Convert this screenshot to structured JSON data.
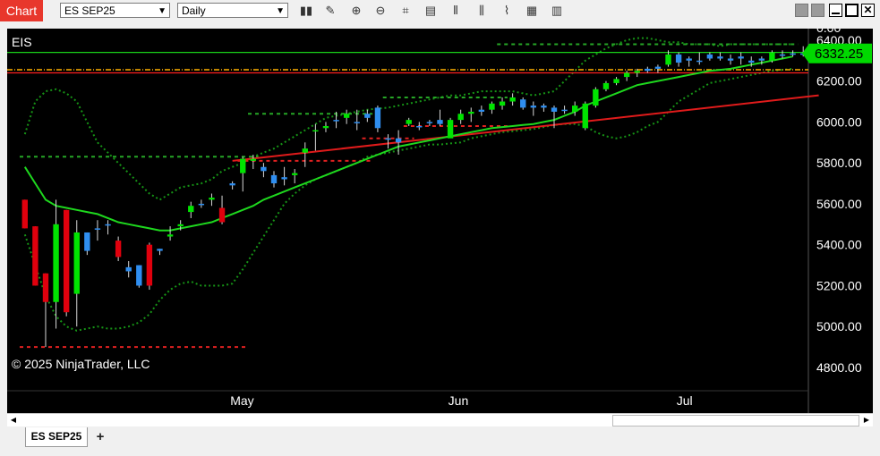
{
  "toolbar": {
    "chart_label": "Chart",
    "instrument": "ES SEP25",
    "interval": "Daily",
    "icons": [
      "bars-type-icon",
      "draw-pencil-icon",
      "zoom-in-icon",
      "zoom-out-icon",
      "crosshair-icon",
      "data-box-icon",
      "indicators-icon",
      "strategies-icon",
      "templates-icon",
      "properties-icon",
      "more-icon"
    ]
  },
  "chart": {
    "instrument_label": "EIS",
    "copyright": "© 2025 NinjaTrader, LLC",
    "last_price": "6332.25",
    "colors": {
      "background": "#000000",
      "up_candle": "#00e400",
      "down_candle": "#e0000d",
      "neutral_candle": "#2f8ef0",
      "sma": "#1ed81e",
      "trend": "#e01b1b",
      "bollinger": "#169416",
      "price_marker": "#00d900",
      "axis_text": "#ffffff"
    }
  },
  "chart_data": {
    "type": "candlestick",
    "y_ticks": [
      "0.00",
      "6400.00",
      "6200.00",
      "6000.00",
      "5800.00",
      "5600.00",
      "5400.00",
      "5200.00",
      "5000.00",
      "4800.00"
    ],
    "ylim": [
      4730,
      6500
    ],
    "x_labels": [
      "May",
      "Jun",
      "Jul"
    ],
    "ohlc": [
      [
        5620,
        5620,
        5480,
        5480,
        "r"
      ],
      [
        5490,
        5490,
        5200,
        5200,
        "r"
      ],
      [
        5260,
        5260,
        4900,
        5120,
        "r"
      ],
      [
        5120,
        5620,
        4990,
        5500,
        "g"
      ],
      [
        5570,
        5570,
        5050,
        5070,
        "r"
      ],
      [
        5160,
        5520,
        5000,
        5460,
        "g"
      ],
      [
        5460,
        5460,
        5350,
        5370,
        "b"
      ],
      [
        5480,
        5520,
        5420,
        5480,
        "b"
      ],
      [
        5500,
        5520,
        5450,
        5500,
        "b"
      ],
      [
        5420,
        5440,
        5320,
        5340,
        "r"
      ],
      [
        5290,
        5320,
        5240,
        5270,
        "b"
      ],
      [
        5300,
        5300,
        5190,
        5200,
        "b"
      ],
      [
        5400,
        5410,
        5180,
        5200,
        "r"
      ],
      [
        5370,
        5380,
        5350,
        5380,
        "b"
      ],
      [
        5440,
        5490,
        5420,
        5450,
        "g"
      ],
      [
        5490,
        5520,
        5470,
        5500,
        "g"
      ],
      [
        5560,
        5610,
        5530,
        5590,
        "g"
      ],
      [
        5600,
        5620,
        5580,
        5600,
        "b"
      ],
      [
        5620,
        5650,
        5590,
        5630,
        "g"
      ],
      [
        5510,
        5640,
        5500,
        5580,
        "r"
      ],
      [
        5690,
        5710,
        5670,
        5700,
        "b"
      ],
      [
        5750,
        5830,
        5660,
        5820,
        "g"
      ],
      [
        5820,
        5840,
        5770,
        5810,
        "g"
      ],
      [
        5780,
        5800,
        5730,
        5760,
        "b"
      ],
      [
        5740,
        5760,
        5680,
        5700,
        "b"
      ],
      [
        5730,
        5780,
        5690,
        5720,
        "b"
      ],
      [
        5740,
        5770,
        5700,
        5750,
        "g"
      ],
      [
        5850,
        5900,
        5780,
        5870,
        "g"
      ],
      [
        5960,
        5990,
        5860,
        5960,
        "g"
      ],
      [
        5970,
        6000,
        5950,
        5980,
        "g"
      ],
      [
        6010,
        6050,
        5970,
        6010,
        "b"
      ],
      [
        6020,
        6060,
        5990,
        6040,
        "g"
      ],
      [
        6000,
        6060,
        5960,
        6000,
        "b"
      ],
      [
        6040,
        6060,
        6000,
        6020,
        "b"
      ],
      [
        6070,
        6080,
        5950,
        5970,
        "b"
      ],
      [
        5920,
        5940,
        5870,
        5920,
        "b"
      ],
      [
        5900,
        5960,
        5840,
        5920,
        "b"
      ],
      [
        5990,
        6020,
        5980,
        6010,
        "g"
      ],
      [
        5980,
        6000,
        5960,
        5980,
        "b"
      ],
      [
        6000,
        6010,
        5980,
        6000,
        "b"
      ],
      [
        6010,
        6060,
        5980,
        5990,
        "b"
      ],
      [
        5920,
        6020,
        5940,
        6010,
        "g"
      ],
      [
        6010,
        6060,
        5990,
        6040,
        "g"
      ],
      [
        6040,
        6070,
        6000,
        6050,
        "g"
      ],
      [
        6050,
        6080,
        6030,
        6060,
        "b"
      ],
      [
        6060,
        6100,
        6040,
        6090,
        "g"
      ],
      [
        6080,
        6120,
        6060,
        6100,
        "g"
      ],
      [
        6100,
        6140,
        6080,
        6120,
        "g"
      ],
      [
        6110,
        6120,
        6060,
        6070,
        "b"
      ],
      [
        6080,
        6100,
        6030,
        6070,
        "b"
      ],
      [
        6070,
        6090,
        6050,
        6080,
        "b"
      ],
      [
        6050,
        6080,
        5970,
        6070,
        "b"
      ],
      [
        6060,
        6080,
        6040,
        6060,
        "b"
      ],
      [
        6050,
        6100,
        6030,
        6080,
        "g"
      ],
      [
        5970,
        6100,
        5960,
        6090,
        "g"
      ],
      [
        6080,
        6170,
        6070,
        6160,
        "g"
      ],
      [
        6160,
        6200,
        6150,
        6190,
        "g"
      ],
      [
        6190,
        6220,
        6180,
        6210,
        "g"
      ],
      [
        6220,
        6250,
        6200,
        6240,
        "g"
      ],
      [
        6240,
        6260,
        6220,
        6250,
        "g"
      ],
      [
        6250,
        6270,
        6240,
        6260,
        "b"
      ],
      [
        6260,
        6280,
        6240,
        6270,
        "b"
      ],
      [
        6280,
        6350,
        6270,
        6330,
        "g"
      ],
      [
        6330,
        6340,
        6270,
        6290,
        "b"
      ],
      [
        6300,
        6320,
        6270,
        6310,
        "b"
      ],
      [
        6300,
        6340,
        6280,
        6300,
        "b"
      ],
      [
        6310,
        6340,
        6300,
        6330,
        "b"
      ],
      [
        6320,
        6340,
        6300,
        6310,
        "b"
      ],
      [
        6300,
        6330,
        6280,
        6310,
        "b"
      ],
      [
        6310,
        6340,
        6280,
        6320,
        "b"
      ],
      [
        6290,
        6320,
        6270,
        6300,
        "b"
      ],
      [
        6300,
        6320,
        6280,
        6310,
        "b"
      ],
      [
        6300,
        6350,
        6290,
        6340,
        "g"
      ],
      [
        6330,
        6350,
        6310,
        6330,
        "b"
      ],
      [
        6330,
        6350,
        6320,
        6335,
        "b"
      ],
      [
        6335,
        6370,
        6320,
        6332.25,
        "b"
      ]
    ],
    "sma": [
      5780,
      5700,
      5620,
      5590,
      5580,
      5570,
      5560,
      5550,
      5530,
      5510,
      5500,
      5490,
      5480,
      5470,
      5470,
      5480,
      5490,
      5500,
      5510,
      5530,
      5550,
      5570,
      5590,
      5620,
      5640,
      5660,
      5680,
      5700,
      5720,
      5740,
      5760,
      5780,
      5800,
      5820,
      5840,
      5860,
      5880,
      5890,
      5900,
      5910,
      5920,
      5930,
      5940,
      5950,
      5960,
      5970,
      5975,
      5980,
      5985,
      5990,
      6000,
      6010,
      6030,
      6050,
      6080,
      6100,
      6120,
      6140,
      6160,
      6180,
      6190,
      6200,
      6210,
      6220,
      6230,
      6240,
      6250,
      6255,
      6260,
      6270,
      6280,
      6290,
      6300,
      6310,
      6320
    ],
    "bb_upper": [
      5940,
      6100,
      6150,
      6160,
      6140,
      6100,
      6000,
      5900,
      5850,
      5800,
      5750,
      5700,
      5650,
      5620,
      5650,
      5680,
      5690,
      5700,
      5720,
      5760,
      5780,
      5800,
      5830,
      5850,
      5870,
      5900,
      5930,
      5960,
      5990,
      6020,
      6030,
      6040,
      6050,
      6060,
      6065,
      6070,
      6080,
      6090,
      6100,
      6110,
      6120,
      6130,
      6130,
      6140,
      6150,
      6150,
      6150,
      6150,
      6140,
      6130,
      6140,
      6150,
      6200,
      6250,
      6300,
      6330,
      6360,
      6380,
      6400,
      6410,
      6410,
      6400,
      6390,
      6390,
      6380,
      6380,
      6380,
      6370,
      6380,
      6380,
      6380,
      6380,
      6380,
      6380,
      6380
    ],
    "bb_lower": [
      5450,
      5300,
      5150,
      5050,
      5000,
      4980,
      4990,
      5000,
      4990,
      4990,
      5000,
      5020,
      5060,
      5130,
      5180,
      5210,
      5220,
      5200,
      5200,
      5200,
      5210,
      5280,
      5360,
      5440,
      5520,
      5600,
      5650,
      5690,
      5720,
      5740,
      5760,
      5780,
      5800,
      5830,
      5840,
      5850,
      5860,
      5870,
      5880,
      5890,
      5890,
      5895,
      5900,
      5920,
      5930,
      5940,
      5950,
      5955,
      5960,
      5965,
      5975,
      5985,
      5990,
      5990,
      5980,
      5950,
      5930,
      5920,
      5930,
      5950,
      5980,
      6000,
      6050,
      6100,
      6130,
      6160,
      6190,
      6200,
      6210,
      6220,
      6230,
      6240,
      6250,
      6255,
      6260
    ],
    "trend_line": {
      "from": [
        20,
        5810
      ],
      "to": [
        75,
        6110
      ]
    },
    "h_lines": [
      {
        "type": "solid",
        "color": "#19d119",
        "value": 6340
      },
      {
        "type": "solid",
        "color": "#ff2020",
        "value": 6240
      },
      {
        "type": "dashdot",
        "color": "#ffb000",
        "value": 6255
      }
    ],
    "dashed_levels": [
      {
        "color": "#26a626",
        "value": 5830,
        "from": 0,
        "to": 22
      },
      {
        "color": "#26a626",
        "value": 6040,
        "from": 22,
        "to": 33
      },
      {
        "color": "#26a626",
        "value": 6120,
        "from": 35,
        "to": 46
      },
      {
        "color": "#26a626",
        "value": 6380,
        "from": 46,
        "to": 74
      },
      {
        "color": "#e02020",
        "value": 4900,
        "from": 0,
        "to": 21
      },
      {
        "color": "#e02020",
        "value": 5810,
        "from": 21,
        "to": 33
      },
      {
        "color": "#e02020",
        "value": 5920,
        "from": 33,
        "to": 37
      },
      {
        "color": "#e02020",
        "value": 5980,
        "from": 37,
        "to": 46
      }
    ]
  },
  "tabs": {
    "active": "ES SEP25",
    "add": "+"
  }
}
